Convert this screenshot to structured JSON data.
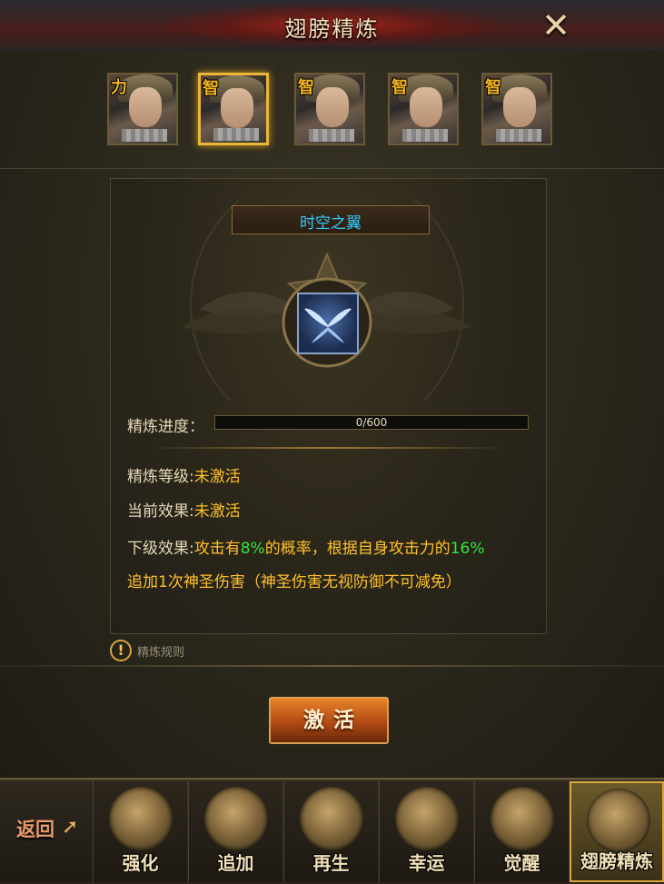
{
  "window": {
    "title": "翅膀精炼"
  },
  "heroes": [
    {
      "tag": "力",
      "selected": false
    },
    {
      "tag": "智",
      "selected": true
    },
    {
      "tag": "智",
      "selected": false
    },
    {
      "tag": "智",
      "selected": false
    },
    {
      "tag": "智",
      "selected": false
    }
  ],
  "wing": {
    "name": "时空之翼"
  },
  "progress": {
    "label": "精炼进度：",
    "current": 0,
    "max": 600,
    "text": "0/600"
  },
  "info": {
    "level_label": "精炼等级:",
    "level_value": "未激活",
    "current_label": "当前效果:",
    "current_value": "未激活",
    "next_label": "下级效果:",
    "next_part1": "攻击有",
    "next_pct1": "8%",
    "next_part2": "的概率，根据自身攻击力的",
    "next_pct2": "16%",
    "next_line2": "追加1次神圣伤害（神圣伤害无视防御不可减免）"
  },
  "rules": {
    "label": "精炼规则"
  },
  "activate_button": {
    "label": "激活"
  },
  "back_button": {
    "label": "返回"
  },
  "tabs": [
    {
      "label": "强化",
      "icon": "axe-emblem-icon",
      "active": false
    },
    {
      "label": "追加",
      "icon": "gem-wing-icon",
      "active": false
    },
    {
      "label": "再生",
      "icon": "orb-wing-icon",
      "active": false
    },
    {
      "label": "幸运",
      "icon": "crystal-icon",
      "active": false
    },
    {
      "label": "觉醒",
      "icon": "sword-wing-icon",
      "active": false
    },
    {
      "label": "翅膀精炼",
      "icon": "wing-helm-icon",
      "active": true
    }
  ],
  "colors": {
    "accent_gold": "#e9b73a",
    "value_yellow": "#ffc12a",
    "value_green": "#33e63c",
    "wing_name_blue": "#35c8ff"
  }
}
